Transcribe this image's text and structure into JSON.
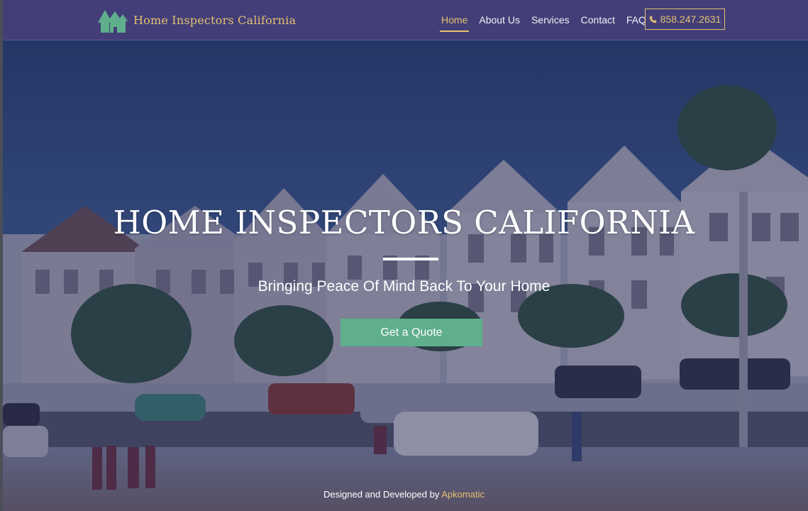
{
  "brand": {
    "name": "Home Inspectors California",
    "logo_icon": "house-trees-logo-icon"
  },
  "nav": {
    "items": [
      {
        "label": "Home",
        "active": true
      },
      {
        "label": "About Us",
        "active": false
      },
      {
        "label": "Services",
        "active": false
      },
      {
        "label": "Contact",
        "active": false
      },
      {
        "label": "FAQ",
        "active": false
      }
    ],
    "phone": {
      "icon": "phone-icon",
      "label": "858.247.2631"
    }
  },
  "hero": {
    "title": "HOME INSPECTORS CALIFORNIA",
    "subtitle": "Bringing Peace Of Mind Back To Your Home",
    "cta_label": "Get a Quote"
  },
  "footer": {
    "credit_prefix": "Designed and Developed by",
    "credit_link": "Apkomatic"
  },
  "colors": {
    "navbar": "#433e78",
    "accent_gold": "#e3c171",
    "cta_green": "#5fae8c",
    "overlay": "#262852"
  }
}
